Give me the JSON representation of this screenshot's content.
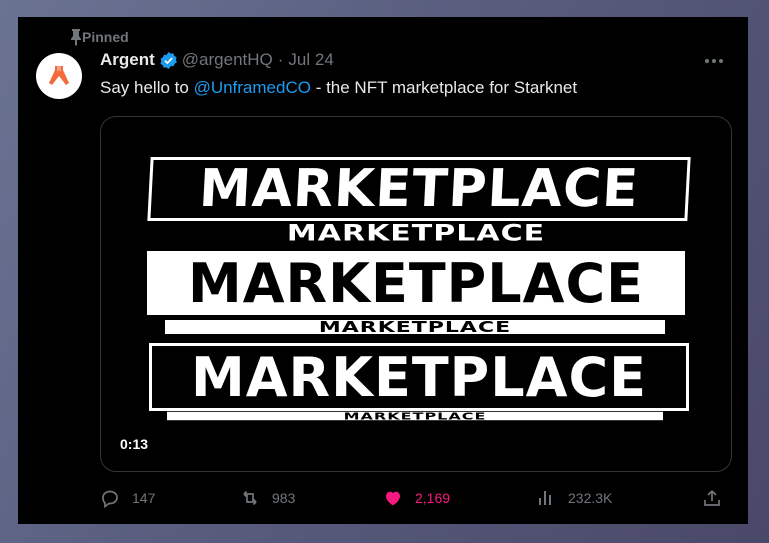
{
  "pinned_label": "Pinned",
  "author": {
    "name": "Argent",
    "handle": "@argentHQ",
    "separator": "·",
    "date": "Jul 24"
  },
  "tweet": {
    "text_before": "Say hello to ",
    "mention": "@UnframedCO",
    "text_after": " - the NFT marketplace for Starknet"
  },
  "media": {
    "bands": [
      "MARKETPLACE",
      "MARKETPLACE",
      "MARKETPLACE",
      "MARKETPLACE",
      "MARKETPLACE",
      "MARKETPLACE"
    ],
    "duration": "0:13"
  },
  "actions": {
    "replies": "147",
    "reposts": "983",
    "likes": "2,169",
    "views": "232.3K"
  },
  "icons": [
    "pin-icon",
    "argent-logo-icon",
    "verified-badge-icon",
    "more-icon",
    "reply-icon",
    "repost-icon",
    "like-icon",
    "views-icon",
    "share-icon"
  ],
  "colors": {
    "background": "#000000",
    "mention": "#1d9bf0",
    "like": "#f91880",
    "muted": "#71767b",
    "avatar_logo": "#f36a3d"
  }
}
